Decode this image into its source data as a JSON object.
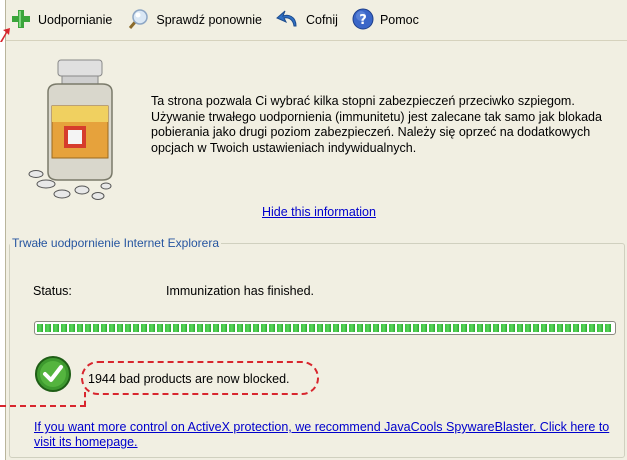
{
  "toolbar": {
    "items": [
      {
        "label": "Uodpornianie",
        "icon": "plus-icon"
      },
      {
        "label": "Sprawdź ponownie",
        "icon": "magnifier-icon"
      },
      {
        "label": "Cofnij",
        "icon": "undo-arrow-icon"
      },
      {
        "label": "Pomoc",
        "icon": "help-icon"
      }
    ]
  },
  "info": {
    "text": "Ta strona pozwala Ci wybrać kilka stopni zabezpieczeń przeciwko szpiegom. Używanie trwałego uodpornienia (immunitetu) jest zalecane tak samo jak blokada pobierania jako drugi poziom zabezpieczeń. Należy się oprzeć na dodatkowych opcjach w Twoich ustawieniach indywidualnych.",
    "hide_link": "Hide this information",
    "illustration": "pill-bottle-icon"
  },
  "immunization": {
    "group_title": "Trwałe uodpornienie Internet Explorera",
    "status_label": "Status:",
    "status_value": "Immunization has finished.",
    "progress": 1.0,
    "blocked_text": "1944 bad products are now blocked.",
    "link_text": "If you want more control on ActiveX protection, we recommend JavaCools SpywareBlaster. Click here to visit its homepage."
  },
  "colors": {
    "panel_bg": "#f1efe2",
    "link": "#0000cc",
    "group_title": "#2655a0",
    "annotation": "#d8262e",
    "progress": "#37c03a"
  }
}
